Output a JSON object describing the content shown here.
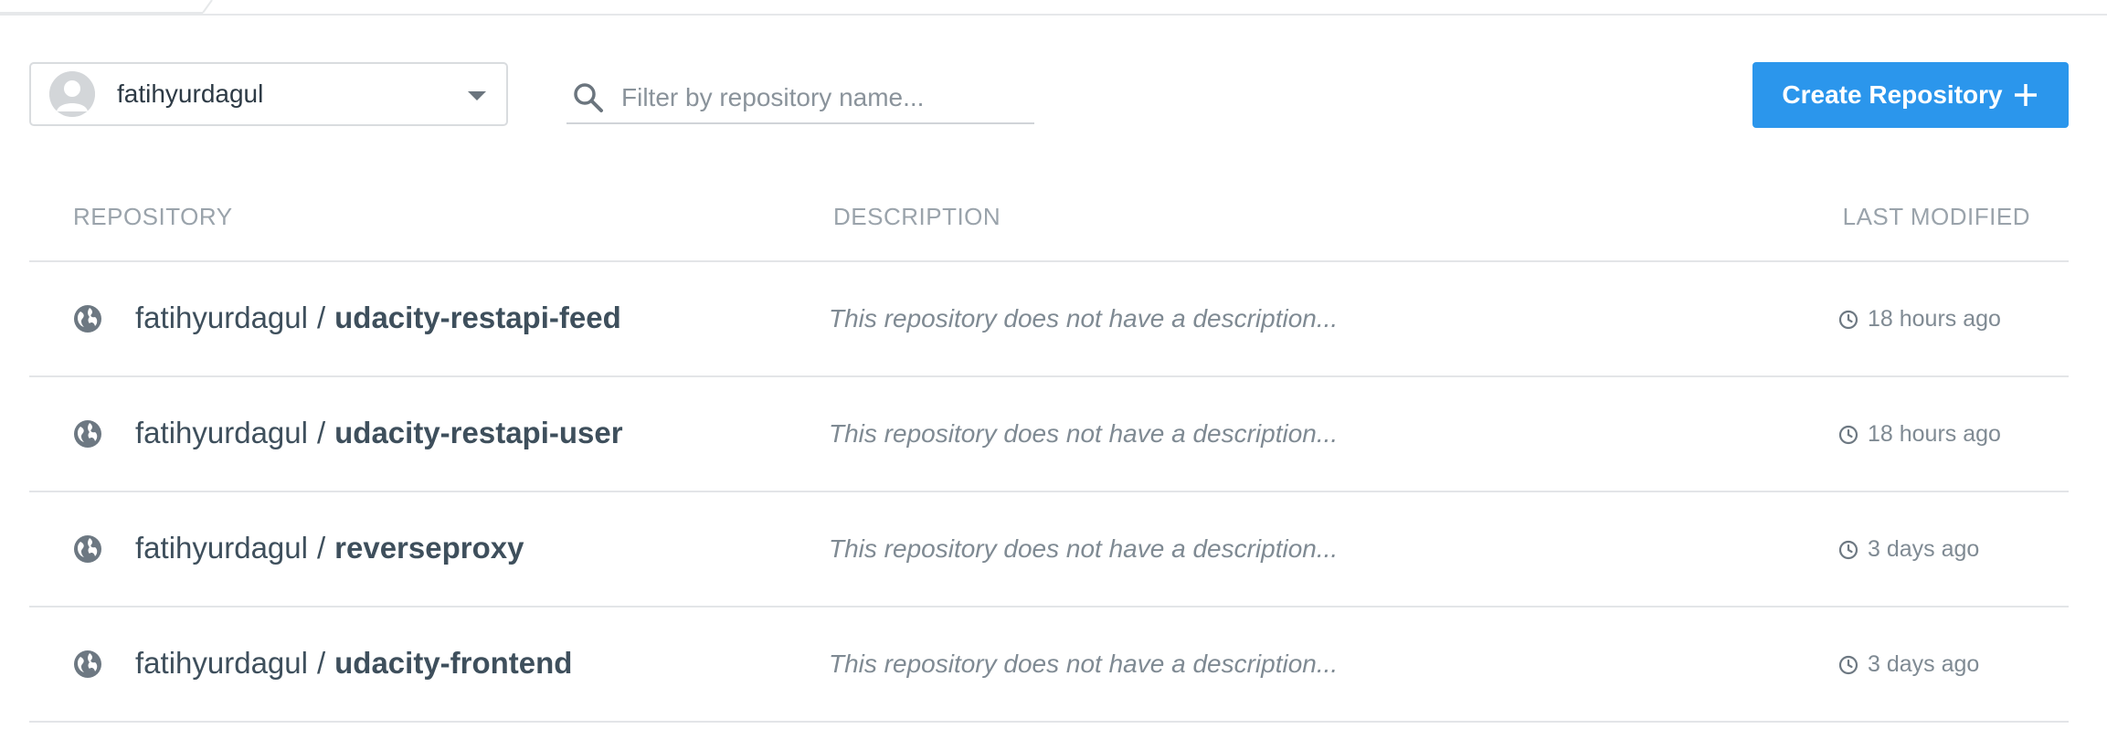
{
  "toolbar": {
    "namespace": "fatihyurdagul",
    "search_placeholder": "Filter by repository name...",
    "create_label": "Create Repository"
  },
  "table": {
    "headers": {
      "repository": "REPOSITORY",
      "description": "DESCRIPTION",
      "last_modified": "LAST MODIFIED"
    },
    "rows": [
      {
        "namespace": "fatihyurdagul",
        "separator": "/",
        "repo": "udacity-restapi-feed",
        "description": "This repository does not have a description...",
        "modified": "18 hours ago"
      },
      {
        "namespace": "fatihyurdagul",
        "separator": "/",
        "repo": "udacity-restapi-user",
        "description": "This repository does not have a description...",
        "modified": "18 hours ago"
      },
      {
        "namespace": "fatihyurdagul",
        "separator": "/",
        "repo": "reverseproxy",
        "description": "This repository does not have a description...",
        "modified": "3 days ago"
      },
      {
        "namespace": "fatihyurdagul",
        "separator": "/",
        "repo": "udacity-frontend",
        "description": "This repository does not have a description...",
        "modified": "3 days ago"
      }
    ]
  },
  "icons": {
    "avatar": "user-avatar-icon",
    "caret": "chevron-down-icon",
    "search": "search-icon",
    "create": "plus-icon",
    "row_visibility": "globe-icon",
    "modified": "clock-icon"
  },
  "colors": {
    "accent": "#2b96ec",
    "text": "#3e4f5c",
    "muted": "#7f8a93",
    "border": "#e3e5e8"
  }
}
